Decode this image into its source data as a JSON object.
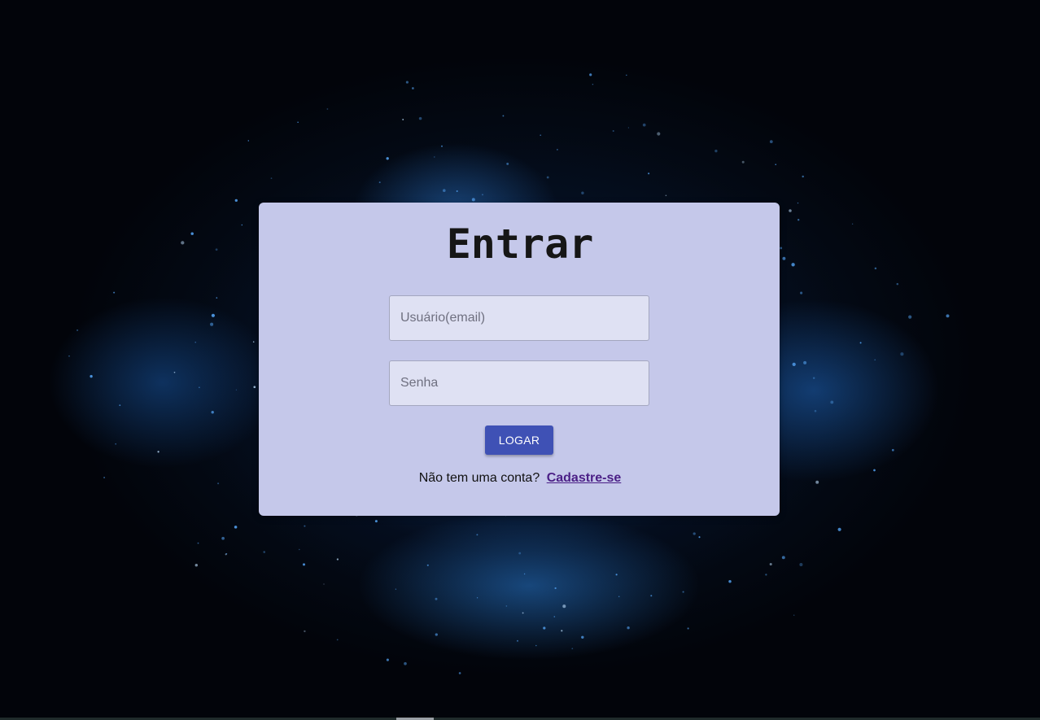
{
  "login": {
    "title": "Entrar",
    "username_placeholder": "Usuário(email)",
    "password_placeholder": "Senha",
    "submit_label": "LOGAR",
    "signup_prompt": "Não tem uma conta?",
    "signup_link": "Cadastre-se"
  },
  "theme": {
    "card_color": "#c5c8ea",
    "button_color": "#3f51b5",
    "link_color": "#4b1f86"
  }
}
